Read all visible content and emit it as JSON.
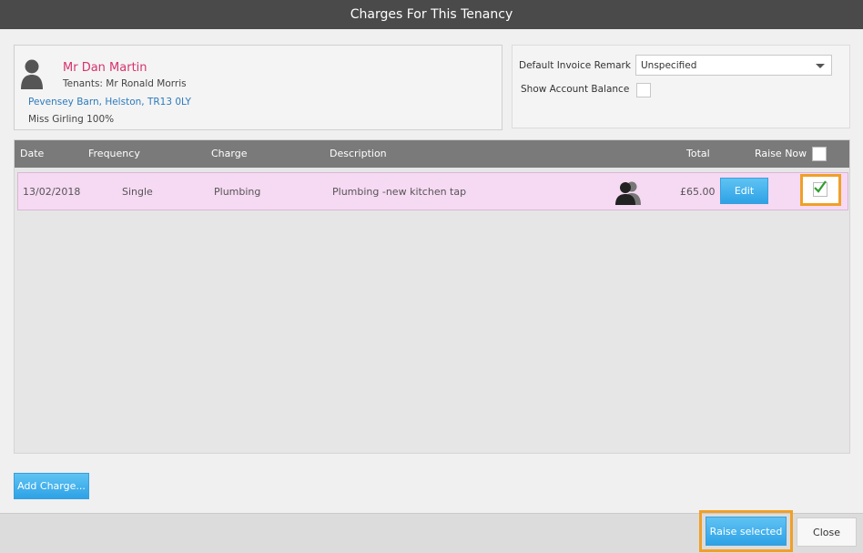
{
  "dialog": {
    "title": "Charges For This Tenancy"
  },
  "tenancy": {
    "landlord_name": "Mr Dan Martin",
    "tenants": "Tenants: Mr Ronald Morris",
    "address": "Pevensey Barn, Helston, TR13 0LY",
    "owner": "Miss Girling 100%"
  },
  "options": {
    "remark_label": "Default Invoice Remark",
    "remark_value": "Unspecified",
    "balance_label": "Show Account Balance",
    "show_balance": false
  },
  "grid": {
    "columns": {
      "date": "Date",
      "frequency": "Frequency",
      "charge": "Charge",
      "description": "Description",
      "total": "Total",
      "raise_now": "Raise Now"
    },
    "select_all": false,
    "rows": [
      {
        "date": "13/02/2018",
        "frequency": "Single",
        "charge": "Plumbing",
        "description": "Plumbing -new kitchen tap",
        "total": "£65.00",
        "edit_label": "Edit",
        "selected": true
      }
    ]
  },
  "actions": {
    "add_charge": "Add Charge...",
    "raise_selected": "Raise selected",
    "close": "Close"
  },
  "colors": {
    "accent_blue": "#2ea2e6",
    "highlight_orange": "#f0a028",
    "row_pink": "#f6d9f3",
    "name_pink": "#d6336c",
    "link_blue": "#2b7bbd",
    "check_green": "#2f9e2f"
  },
  "icons": {
    "avatar": "person-silhouette-icon",
    "row_tenant": "people-silhouette-icon",
    "dropdown": "chevron-down-icon",
    "check": "checkmark-icon"
  }
}
